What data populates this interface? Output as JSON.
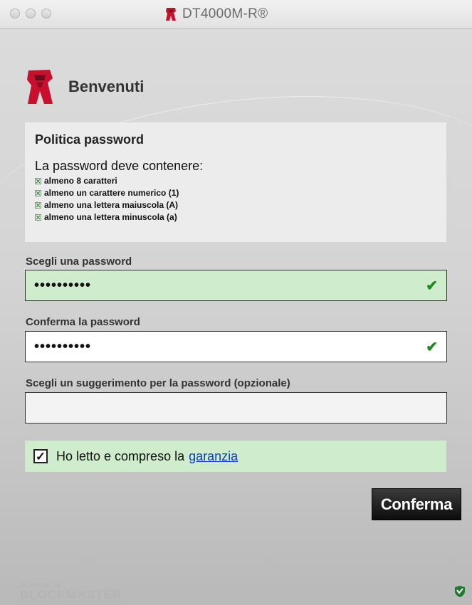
{
  "window": {
    "title": "DT4000M-R®"
  },
  "welcome": {
    "text": "Benvenuti"
  },
  "policy": {
    "title": "Politica password",
    "lead": "La password deve contenere:",
    "rules": [
      "almeno 8 caratteri",
      "almeno un carattere numerico (1)",
      "almeno una lettera maiuscola (A)",
      "almeno una lettera minuscola (a)"
    ]
  },
  "password": {
    "label": "Scegli una password",
    "value": "••••••••••",
    "status": "✔"
  },
  "confirm_password": {
    "label": "Conferma la password",
    "value": "••••••••••",
    "status": "✔"
  },
  "hint": {
    "label": "Scegli un suggerimento per la password (opzionale)",
    "value": ""
  },
  "agreement": {
    "checked": true,
    "check_mark": "✓",
    "text": "Ho letto e compreso la",
    "link": "garanzia"
  },
  "buttons": {
    "confirm": "Conferma"
  },
  "footer": {
    "powered_by": "Powered by",
    "brand": "BLOCKMASTER"
  },
  "colors": {
    "accent_green": "#cfeccc",
    "check_green": "#1f8a1f",
    "link_blue": "#0a3cc8",
    "brand_red": "#c8102e"
  },
  "icons": {
    "title_logo": "kingston-logo-icon",
    "welcome_logo": "kingston-logo-icon",
    "footer": "shield-icon"
  }
}
